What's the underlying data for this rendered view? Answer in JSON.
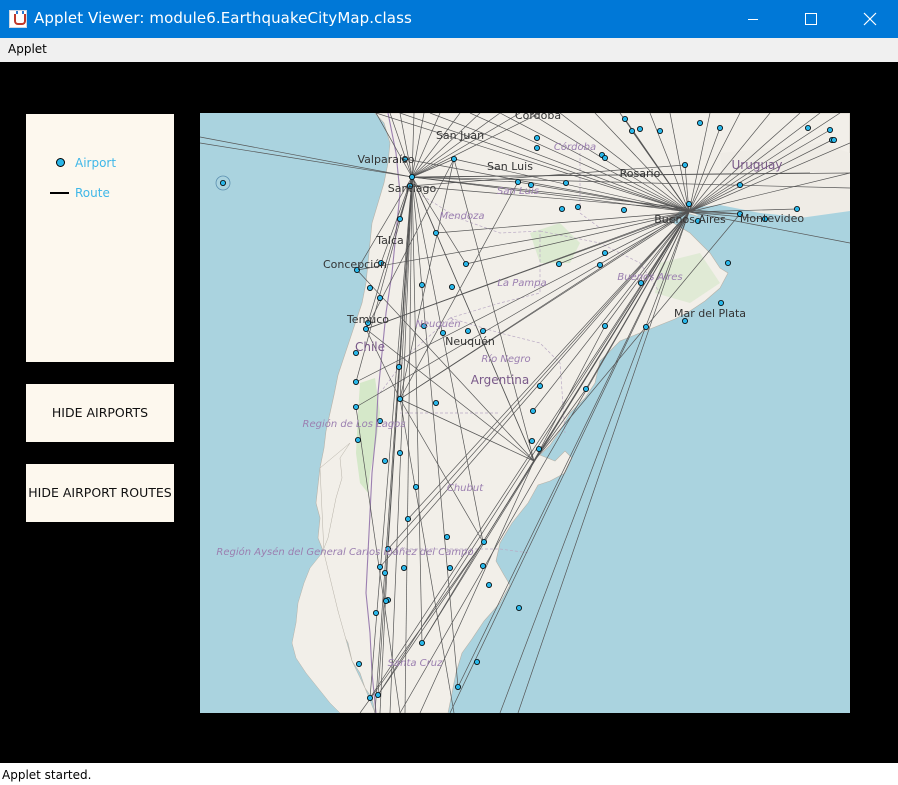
{
  "window": {
    "title": "Applet Viewer: module6.EarthquakeCityMap.class"
  },
  "menu": {
    "items": [
      "Applet"
    ]
  },
  "legend": {
    "airport_label": "Airport",
    "route_label": "Route",
    "airport_color": "#29b6e8",
    "label_color": "#3fb7e8"
  },
  "buttons": {
    "hide_airports": "HIDE AIRPORTS",
    "hide_routes": "HIDE AIRPORT ROUTES"
  },
  "map": {
    "cities": [
      "Córdoba",
      "San Juan",
      "Valparaíso",
      "Santiago",
      "San Luis",
      "Rosario",
      "Buenos Aires",
      "Montevideo",
      "Talca",
      "Concepción",
      "Temuco",
      "Neuquén",
      "Mar del Plata",
      "Argentina",
      "Chile",
      "Uruguay"
    ],
    "regions": [
      "Córdoba",
      "San Luis",
      "Mendoza",
      "La Pampa",
      "Buenos Aires",
      "Neuquén",
      "Río Negro",
      "Región de Los Lagos",
      "Chubut",
      "Región Aysén del General Carlos Ibáñez del Campo",
      "Santa Cruz"
    ],
    "colors": {
      "water": "#aad3df",
      "land": "#f2efe9",
      "route": "#555555",
      "airport": "#29b6e8"
    }
  },
  "status": {
    "text": "Applet started."
  }
}
